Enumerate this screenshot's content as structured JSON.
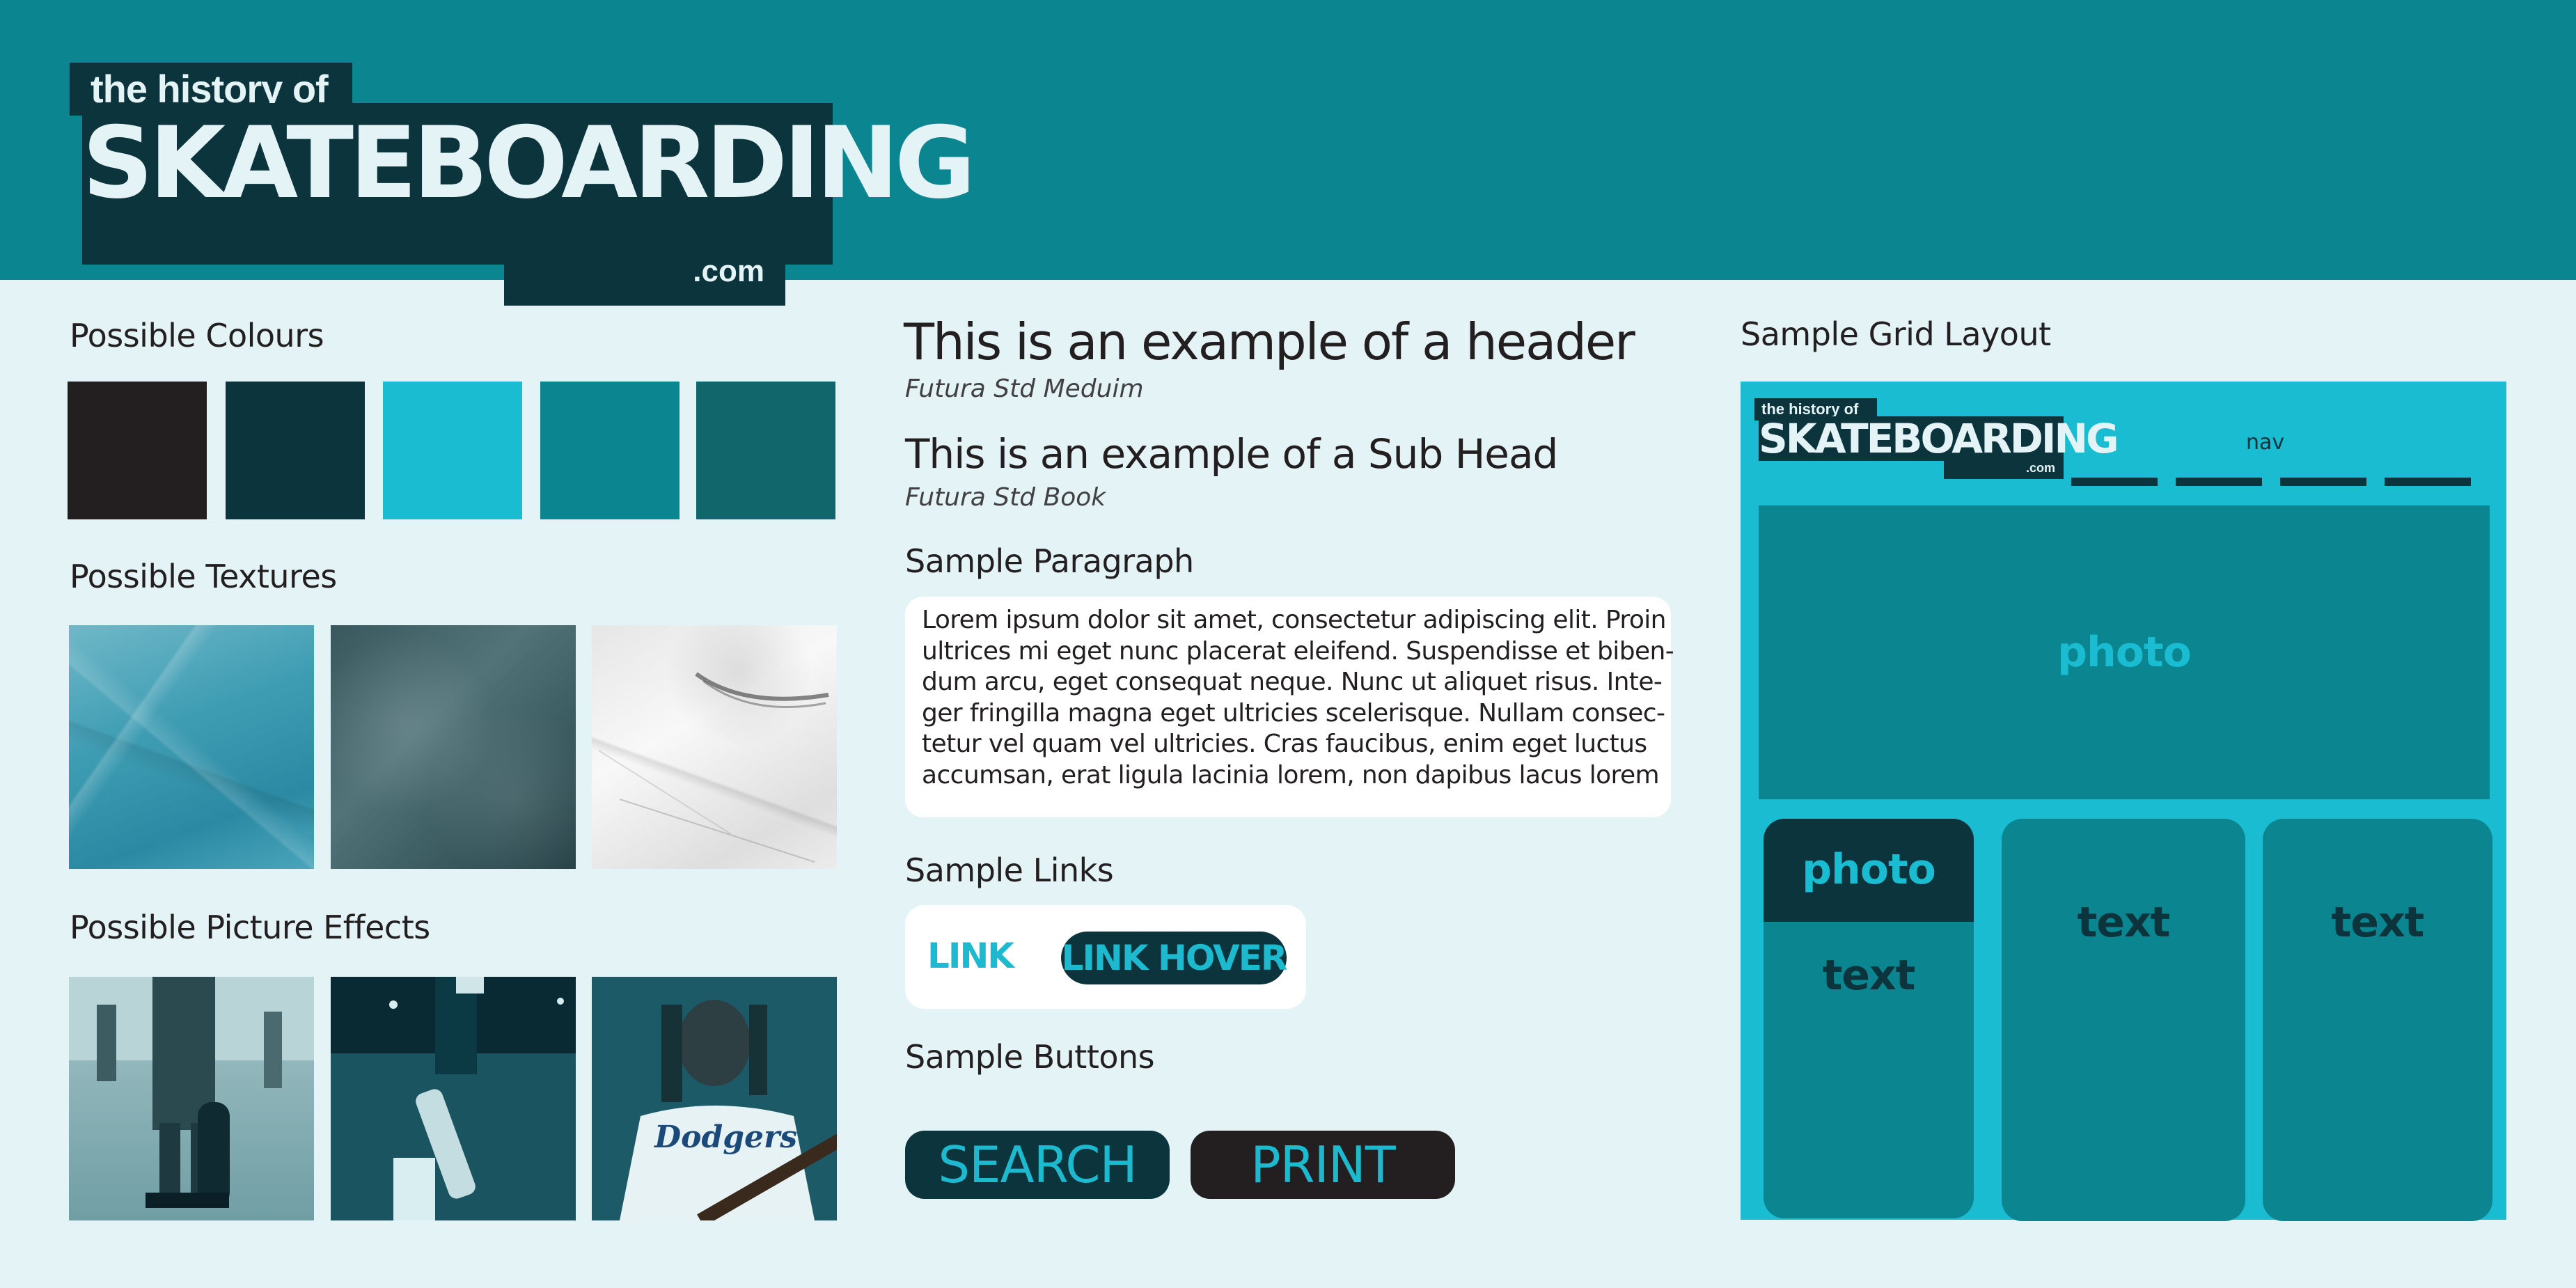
{
  "logo": {
    "line_top": "the history of",
    "line_main": "SKATEBOARDING",
    "line_bottom": ".com"
  },
  "colours": {
    "heading": "Possible Colours",
    "swatches": [
      "#231f20",
      "#0b343d",
      "#19bcd1",
      "#0b8590",
      "#10666b"
    ]
  },
  "textures": {
    "heading": "Possible Textures"
  },
  "picture_effects": {
    "heading": "Possible Picture Effects"
  },
  "typography": {
    "header_sample": "This is an example of a header",
    "header_font": "Futura Std Meduim",
    "subhead_sample": "This is an example of a Sub Head",
    "subhead_font": "Futura Std Book"
  },
  "paragraph": {
    "heading": "Sample Paragraph",
    "lines": [
      "Lorem ipsum dolor sit amet, consectetur adipiscing elit. Proin",
      "ultrices mi eget nunc placerat eleifend. Suspendisse et biben-",
      "dum arcu, eget consequat neque. Nunc ut aliquet risus. Inte-",
      "ger fringilla magna eget ultricies scelerisque. Nullam consec-",
      "tetur vel quam vel ultricies. Cras faucibus, enim eget luctus",
      "accumsan, erat ligula lacinia lorem, non dapibus lacus lorem"
    ]
  },
  "links": {
    "heading": "Sample Links",
    "link_label": "LINK",
    "hover_label": "LINK HOVER"
  },
  "buttons": {
    "heading": "Sample Buttons",
    "search_label": "SEARCH",
    "print_label": "PRINT"
  },
  "grid": {
    "heading": "Sample Grid Layout",
    "nav_label": "nav",
    "hero_label": "photo",
    "card1_photo_label": "photo",
    "card1_text_label": "text",
    "card2_label": "text",
    "card3_label": "text"
  },
  "colors": {
    "band": "#0b8590",
    "page_bg": "#e4f3f5",
    "dark_teal": "#0b343d",
    "bright_cyan": "#19bcd1",
    "link_cyan": "#1db9cf"
  }
}
